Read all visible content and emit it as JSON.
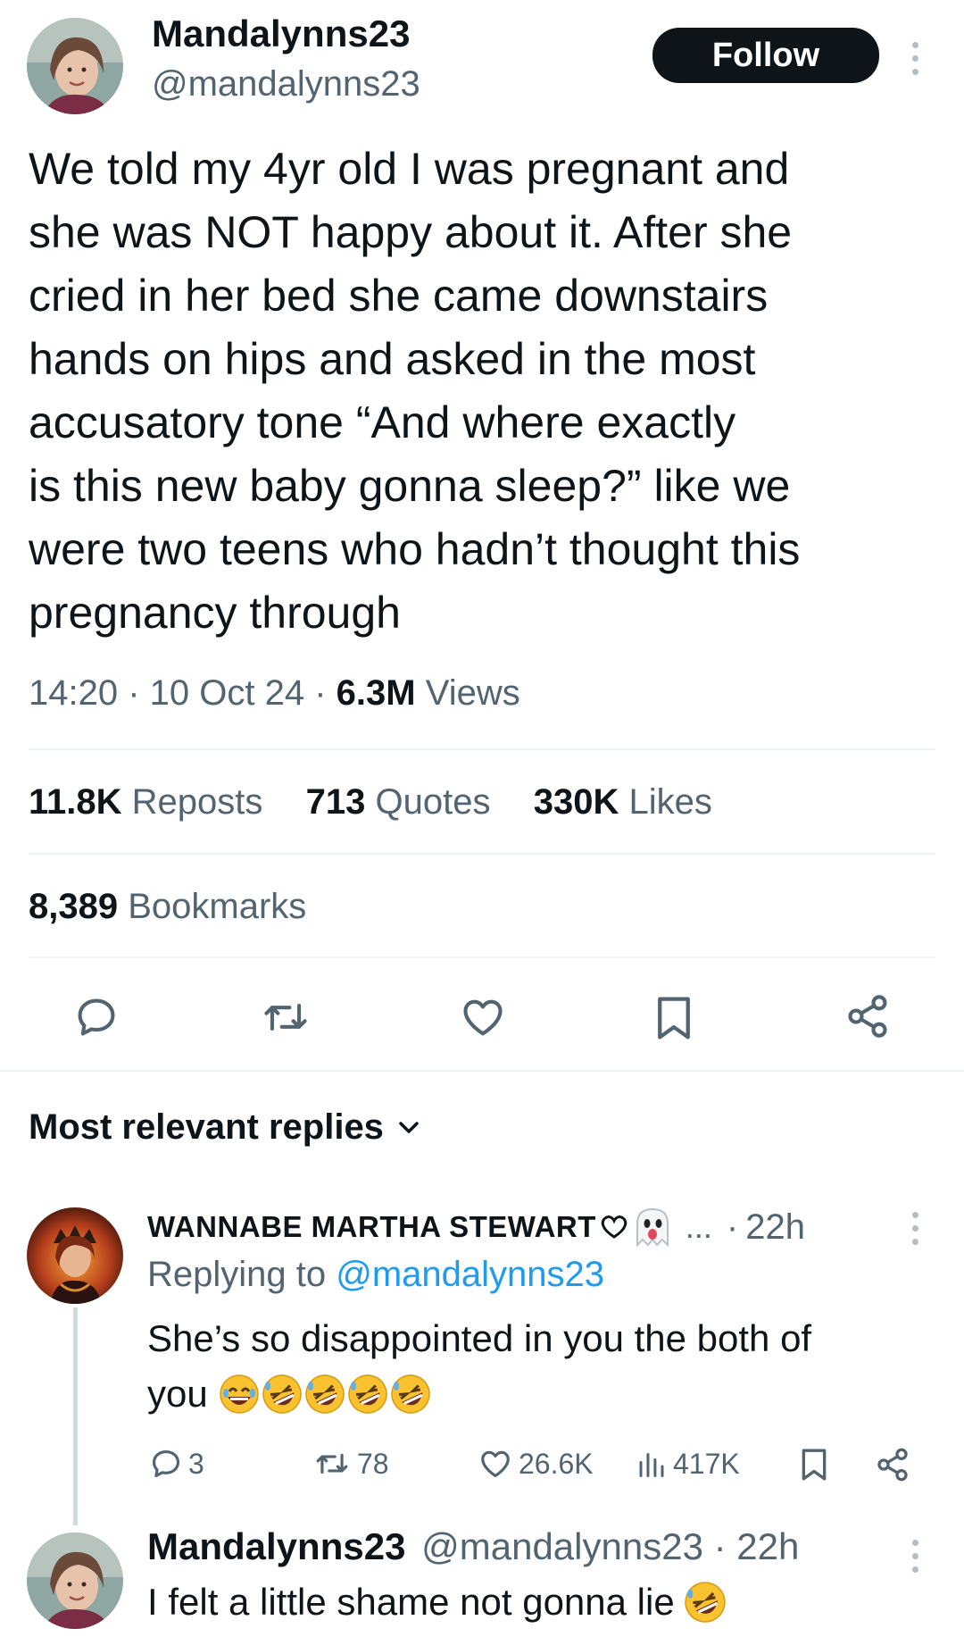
{
  "tweet": {
    "author_name": "Mandalynns23",
    "author_handle": "@mandalynns23",
    "follow_label": "Follow",
    "text_lines": [
      "We told my 4yr old I was pregnant and",
      "she was NOT happy about it. After she",
      "cried in her bed she came downstairs",
      "hands on hips and asked in the most",
      "accusatory tone “And where exactly",
      "is this new baby gonna sleep?” like we",
      "were two teens who hadn’t thought this",
      "pregnancy through"
    ],
    "time": "14:20",
    "date": "10 Oct 24",
    "views_count": "6.3M",
    "views_label": "Views",
    "reposts_count": "11.8K",
    "reposts_label": "Reposts",
    "quotes_count": "713",
    "quotes_label": "Quotes",
    "likes_count": "330K",
    "likes_label": "Likes",
    "bookmarks_count": "8,389",
    "bookmarks_label": "Bookmarks",
    "action_icons": [
      "reply-icon",
      "repost-icon",
      "like-icon",
      "bookmark-icon",
      "share-icon"
    ]
  },
  "replies_header": {
    "label": "Most relevant replies"
  },
  "replies": [
    {
      "author_name": "WANNABE MARTHA STEWART",
      "ellipsis": "...",
      "time": "22h",
      "replying_prefix": "Replying to",
      "replying_handle": "@mandalynns23",
      "text_line1": "She’s so disappointed in you the both of",
      "text_line2": "you",
      "reply_count": "3",
      "repost_count": "78",
      "like_count": "26.6K",
      "view_count": "417K"
    },
    {
      "author_name": "Mandalynns23",
      "author_handle": "@mandalynns23",
      "time": "22h",
      "text": "I felt a little shame not gonna lie"
    }
  ],
  "colors": {
    "text": "#0f1419",
    "muted": "#536471",
    "link": "#1d9bf0",
    "divider": "#eff3f4",
    "follow_bg": "#0f1419"
  }
}
